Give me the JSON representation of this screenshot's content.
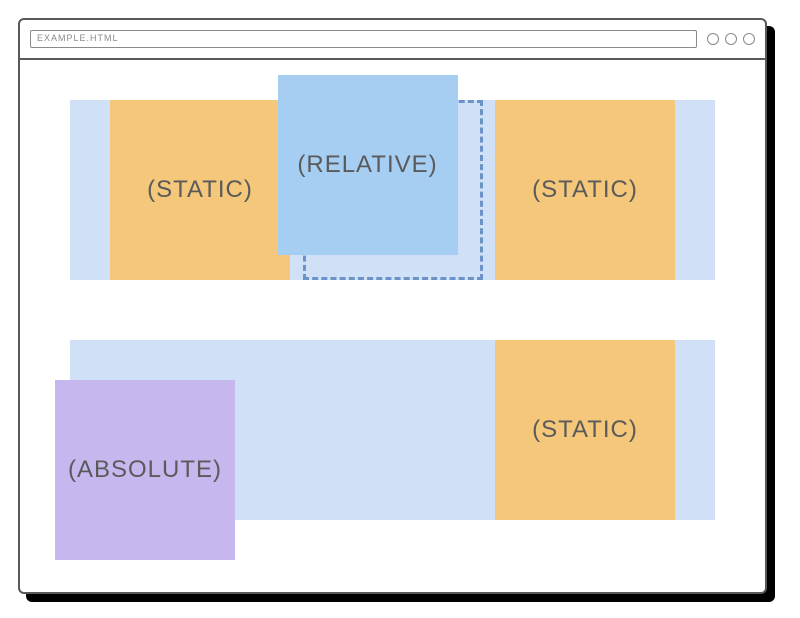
{
  "chrome": {
    "url": "EXAMPLE.HTML"
  },
  "row1": {
    "left": "(STATIC)",
    "center": "(RELATIVE)",
    "right": "(STATIC)"
  },
  "row2": {
    "absolute": "(ABSOLUTE)",
    "right": "(STATIC)"
  }
}
